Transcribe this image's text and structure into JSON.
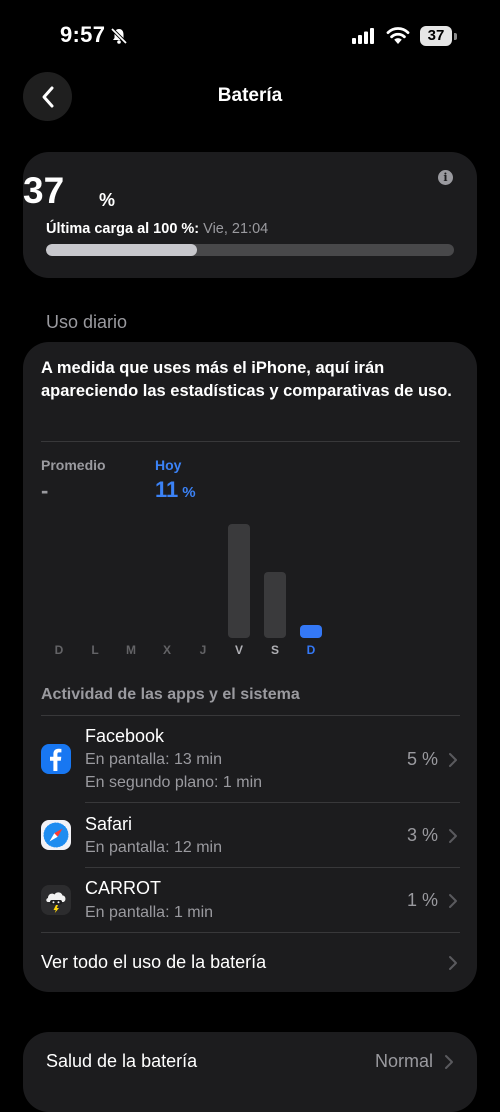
{
  "status_bar": {
    "time": "9:57",
    "battery_level": "37"
  },
  "nav": {
    "title": "Batería"
  },
  "level": {
    "value": "37",
    "unit": "%",
    "last_charge_label": "Última carga al 100 %:",
    "last_charge_value": "Vie, 21:04",
    "progress_fraction": 0.37
  },
  "daily": {
    "section_title": "Uso diario",
    "description": "A medida que uses más el iPhone, aquí irán apareciendo las estadísticas y comparativas de uso.",
    "average_label": "Promedio",
    "average_value": "-",
    "today_label": "Hoy",
    "today_value": "11",
    "today_unit": "%",
    "days": [
      "D",
      "L",
      "M",
      "X",
      "J",
      "V",
      "S",
      "D"
    ]
  },
  "chart_data": {
    "type": "bar",
    "categories": [
      "D",
      "L",
      "M",
      "X",
      "J",
      "V",
      "S",
      "D"
    ],
    "values": [
      0,
      0,
      0,
      0,
      0,
      100,
      58,
      11
    ],
    "highlight_index": 7,
    "colors": {
      "bar": "#3a3a3c",
      "today": "#3478f6"
    }
  },
  "activity": {
    "title": "Actividad de las apps y el sistema",
    "apps": [
      {
        "name": "Facebook",
        "line1": "En pantalla: 13 min",
        "line2": "En segundo plano: 1 min",
        "percent": "5 %",
        "icon": "facebook-icon"
      },
      {
        "name": "Safari",
        "line1": "En pantalla: 12 min",
        "percent": "3 %",
        "icon": "safari-icon"
      },
      {
        "name": "CARROT",
        "line1": "En pantalla: 1 min",
        "percent": "1 %",
        "icon": "carrot-icon"
      }
    ],
    "see_all": "Ver todo el uso de la batería"
  },
  "health": {
    "label": "Salud de la batería",
    "value": "Normal"
  },
  "colors": {
    "accent": "#3b82f6",
    "card": "#1c1c1e",
    "secondary_text": "#9a9a9f"
  }
}
